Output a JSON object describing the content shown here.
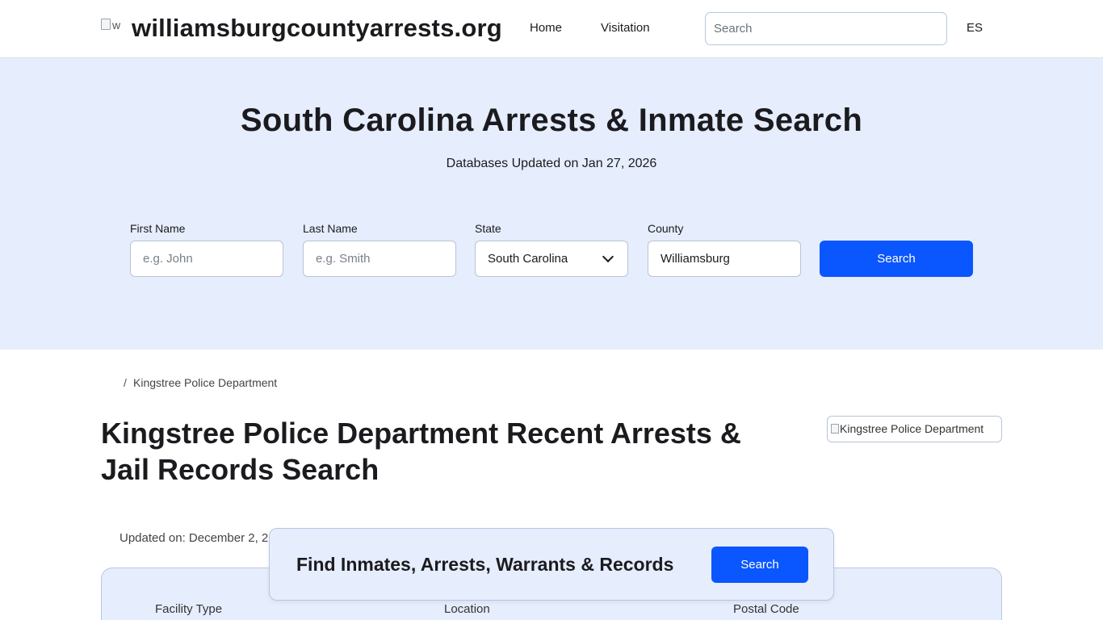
{
  "header": {
    "logo_alt": "w",
    "site_name": "williamsburgcountyarrests.org",
    "nav": {
      "home": "Home",
      "visitation": "Visitation"
    },
    "search_placeholder": "Search",
    "language": "ES"
  },
  "hero": {
    "title": "South Carolina Arrests & Inmate Search",
    "subtitle": "Databases Updated on Jan 27, 2026",
    "form": {
      "first_name_label": "First Name",
      "first_name_placeholder": "e.g. John",
      "last_name_label": "Last Name",
      "last_name_placeholder": "e.g. Smith",
      "state_label": "State",
      "state_value": "South Carolina",
      "county_label": "County",
      "county_value": "Williamsburg",
      "search_button": "Search"
    }
  },
  "breadcrumb": {
    "separator": "/",
    "current": "Kingstree Police Department"
  },
  "page": {
    "title": "Kingstree Police Department Recent Arrests & Jail Records Search",
    "image_alt": "Kingstree Police Department",
    "updated": "Updated on: December 2, 2"
  },
  "info_card": {
    "facility_type_label": "Facility Type",
    "location_label": "Location",
    "postal_code_label": "Postal Code"
  },
  "cta": {
    "text": "Find Inmates, Arrests, Warrants & Records",
    "button": "Search"
  },
  "colors": {
    "accent": "#0a56ff",
    "hero_bg": "#e6edfc",
    "text": "#1b1b1f"
  }
}
